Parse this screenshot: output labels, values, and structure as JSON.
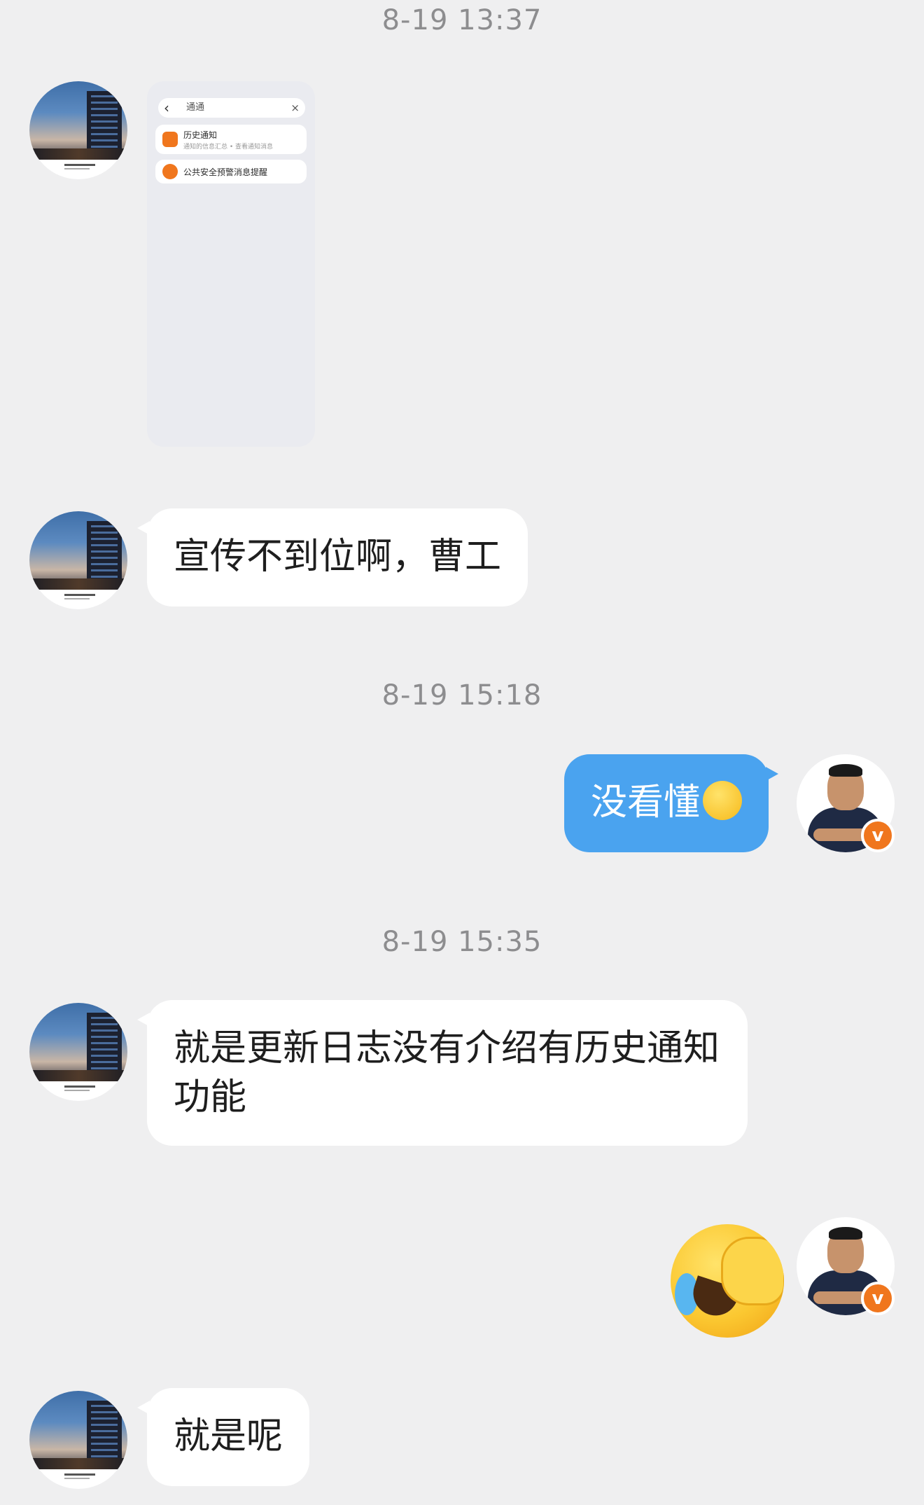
{
  "timestamps": [
    "8-19 13:37",
    "8-19 15:18",
    "8-19 15:35"
  ],
  "messages": {
    "m2_text": "宣传不到位啊，曹工",
    "m3_text": "没看懂",
    "m4_text": "就是更新日志没有介绍有历史通知功能",
    "m6_text": "就是呢"
  },
  "shared_screenshot": {
    "search_query": "通通",
    "result1_title": "历史通知",
    "result1_sub": "通知的信息汇总 • 查看通知消息",
    "result2_title": "公共安全预警消息提醒",
    "back_glyph": "‹",
    "close_glyph": "×"
  },
  "badge": {
    "label": "v",
    "color": "#f0761d"
  },
  "colors": {
    "right_bubble": "#4aa3ef",
    "left_bubble": "#ffffff",
    "background": "#efeff0"
  },
  "emojis": {
    "inline": "laughing-crying-emoji",
    "sticker": "facepalm-laughing-emoji"
  }
}
